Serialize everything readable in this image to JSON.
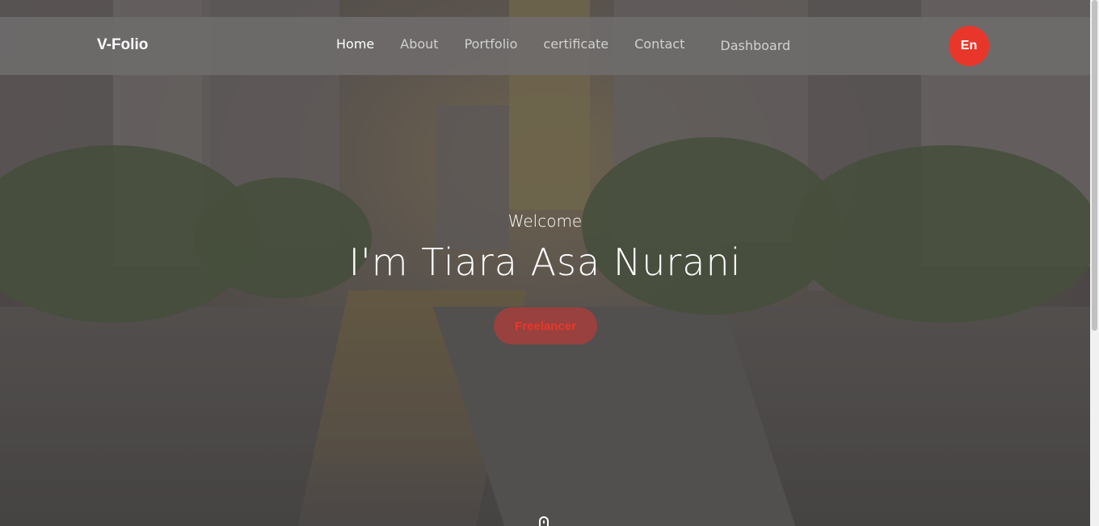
{
  "navbar": {
    "brand": "V-Folio",
    "links": [
      {
        "label": "Home",
        "active": true
      },
      {
        "label": "About",
        "active": false
      },
      {
        "label": "Portfolio",
        "active": false
      },
      {
        "label": "certificate",
        "active": false
      },
      {
        "label": "Contact",
        "active": false
      }
    ],
    "dashboard_label": "Dashboard",
    "lang_label": "En"
  },
  "hero": {
    "welcome": "Welcome",
    "name": "I'm Tiara Asa Nurani",
    "badge": "Freelancer"
  },
  "colors": {
    "accent": "#e8372a",
    "navbar_bg": "#6e6c6c",
    "text": "#ffffff"
  },
  "icons": {
    "scroll_indicator": "mouse-icon"
  }
}
